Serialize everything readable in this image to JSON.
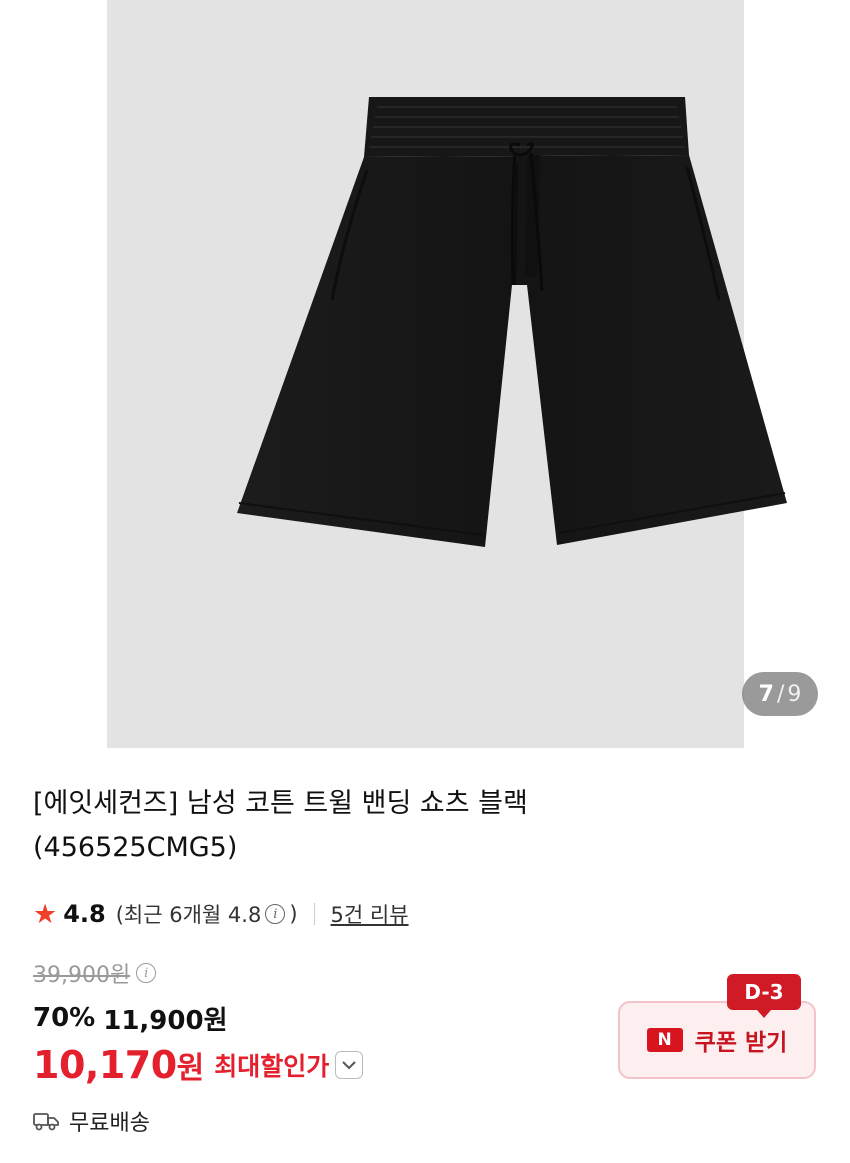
{
  "gallery": {
    "current": "7",
    "separator": "/",
    "total": "9"
  },
  "product": {
    "title_line1": "[에잇세컨즈] 남성 코튼 트윌 밴딩 쇼츠 블랙",
    "title_line2": "(456525CMG5)"
  },
  "rating": {
    "star_icon": "★",
    "score": "4.8",
    "recent_prefix": "(최근 6개월 4.8",
    "recent_suffix": ")",
    "info_icon": "i",
    "reviews_link": "5건 리뷰"
  },
  "price": {
    "original": "39,900원",
    "discount_percent": "70%",
    "sale_price": "11,900원",
    "max_discount_amount": "10,170",
    "max_discount_won": "원",
    "max_discount_label": "최대할인가",
    "chevron_icon": "⌄"
  },
  "shipping": {
    "label": "무료배송",
    "icon": "truck-icon"
  },
  "coupon": {
    "badge": "N",
    "label": "쿠폰 받기",
    "dday": "D-3"
  },
  "colors": {
    "accent_red": "#e4202e",
    "coupon_bg": "#fdeff0",
    "hero_bg": "#e3e3e4"
  }
}
